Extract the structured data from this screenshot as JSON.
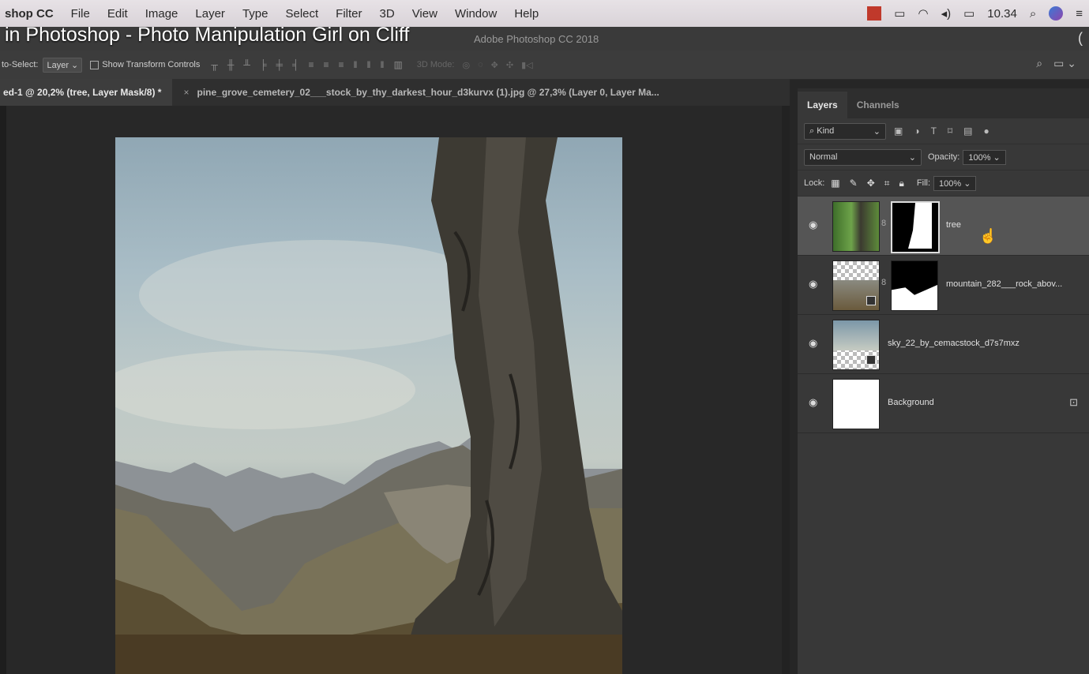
{
  "menubar": {
    "app_name": "shop CC",
    "items": [
      "File",
      "Edit",
      "Image",
      "Layer",
      "Type",
      "Select",
      "Filter",
      "3D",
      "View",
      "Window",
      "Help"
    ],
    "clock": "10.34"
  },
  "caption": "in Photoshop - Photo Manipulation Girl on Cliff",
  "window_title": "Adobe Photoshop CC 2018",
  "options_bar": {
    "auto_select_label": "to-Select:",
    "auto_select_value": "Layer",
    "show_transform_label": "Show Transform Controls",
    "mode_3d_label": "3D Mode:"
  },
  "tabs": {
    "active": "ed-1 @ 20,2% (tree, Layer Mask/8) *",
    "inactive": "pine_grove_cemetery_02___stock_by_thy_darkest_hour_d3kurvx (1).jpg @ 27,3% (Layer 0, Layer Ma...",
    "close_glyph": "×"
  },
  "layers_panel": {
    "tab_layers": "Layers",
    "tab_channels": "Channels",
    "kind_label": "Kind",
    "blend_mode": "Normal",
    "opacity_label": "Opacity:",
    "opacity_value": "100%",
    "lock_label": "Lock:",
    "fill_label": "Fill:",
    "fill_value": "100%",
    "layers": [
      {
        "name": "tree",
        "selected": true
      },
      {
        "name": "mountain_282___rock_abov...",
        "selected": false
      },
      {
        "name": "sky_22_by_cemacstock_d7s7mxz",
        "selected": false
      },
      {
        "name": "Background",
        "selected": false
      }
    ]
  },
  "colors": {
    "accent_selected_layer": "#555555",
    "panel_bg": "#383838"
  }
}
